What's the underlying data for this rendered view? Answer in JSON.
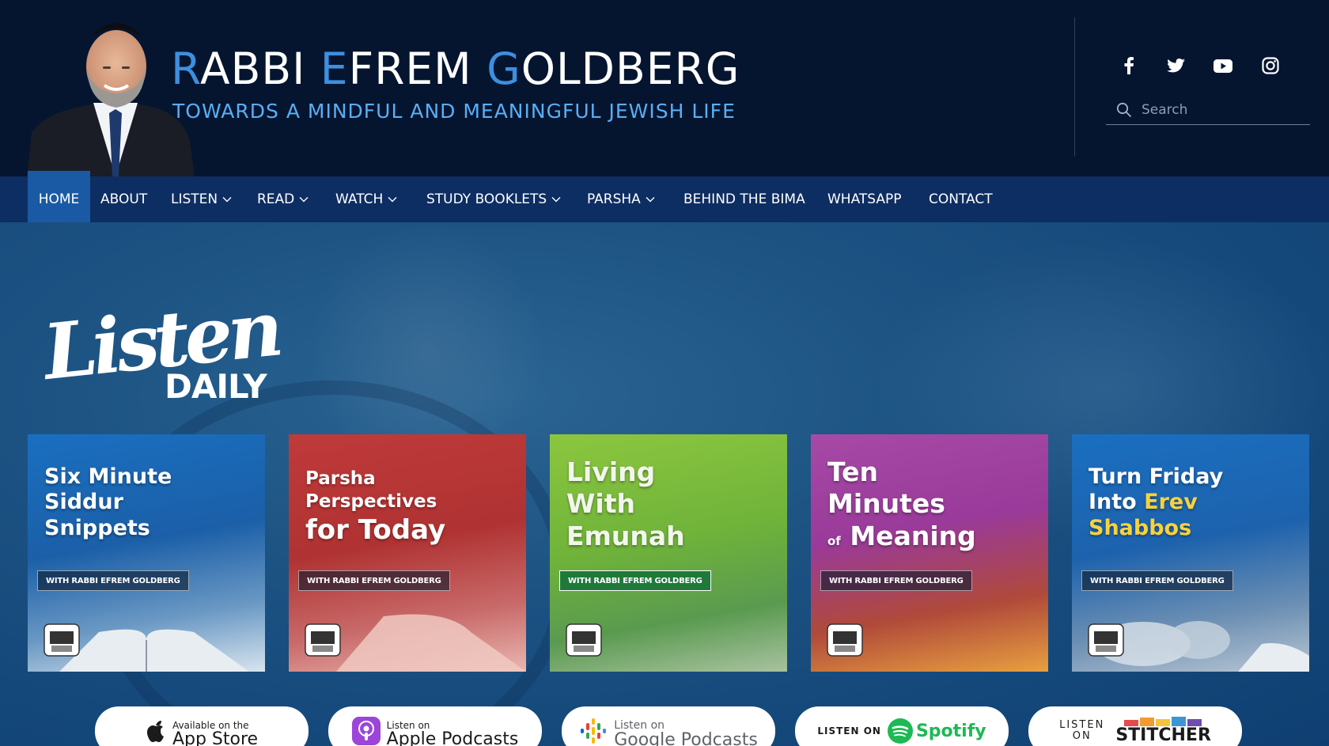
{
  "header": {
    "title_parts": [
      {
        "letter": "R",
        "rest": "ABBI "
      },
      {
        "letter": "E",
        "rest": "FREM "
      },
      {
        "letter": "G",
        "rest": "OLDBERG"
      }
    ],
    "tagline": "TOWARDS A MINDFUL AND MEANINGFUL JEWISH LIFE",
    "search_placeholder": "Search"
  },
  "nav": {
    "items": [
      {
        "label": "HOME",
        "dropdown": false
      },
      {
        "label": "ABOUT",
        "dropdown": false
      },
      {
        "label": "LISTEN",
        "dropdown": true
      },
      {
        "label": "READ",
        "dropdown": true
      },
      {
        "label": "WATCH",
        "dropdown": true
      },
      {
        "label": "STUDY BOOKLETS",
        "dropdown": true
      },
      {
        "label": "PARSHA",
        "dropdown": true
      },
      {
        "label": "BEHIND THE BIMA",
        "dropdown": false
      },
      {
        "label": "WHATSAPP",
        "dropdown": false
      },
      {
        "label": "CONTACT",
        "dropdown": false
      }
    ]
  },
  "hero": {
    "logo_script": "Listen",
    "logo_caps": "DAILY",
    "badge_text": "WITH RABBI EFREM GOLDBERG",
    "cards": [
      {
        "lines": [
          "Six Minute",
          "Siddur",
          "Snippets"
        ]
      },
      {
        "lines": [
          "Parsha",
          "Perspectives",
          "for Today"
        ]
      },
      {
        "lines": [
          "Living",
          "With",
          "Emunah"
        ]
      },
      {
        "lines": [
          "Ten",
          "Minutes",
          "of",
          "Meaning"
        ]
      },
      {
        "lines": [
          "Turn Friday",
          "Into",
          "Erev",
          "Shabbos"
        ]
      }
    ]
  },
  "apps": {
    "app_store": {
      "small": "Available on the",
      "big": "App Store"
    },
    "apple_podcasts": {
      "small": "Listen on",
      "big": "Apple Podcasts"
    },
    "google_podcasts": {
      "small": "Listen on",
      "big": "Google Podcasts"
    },
    "spotify": {
      "small": "LISTEN ON",
      "big": "Spotify"
    },
    "stitcher": {
      "small1": "LISTEN",
      "small2": "ON",
      "big": "STITCHER"
    }
  },
  "colors": {
    "header_bg": "#051530",
    "nav_bg": "#0d2e62",
    "nav_active": "#1a5aa5",
    "title_accent": "#3d8fe0",
    "tagline": "#5aaef5"
  }
}
